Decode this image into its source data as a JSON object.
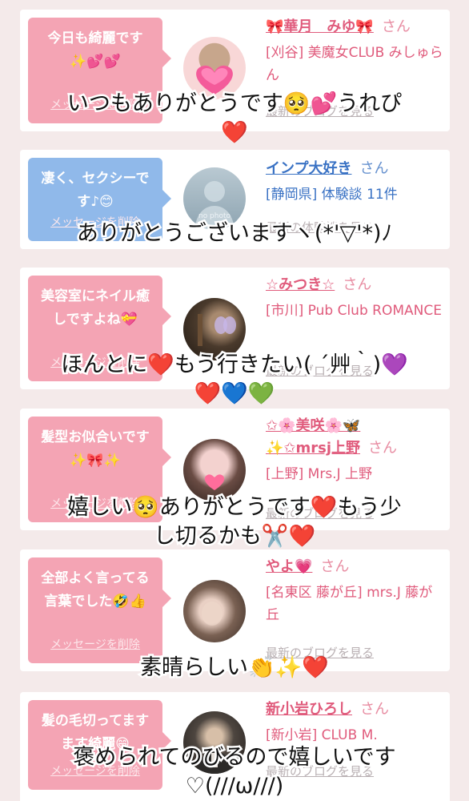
{
  "cards": [
    {
      "bubble_text": "今日も綺麗です\n✨💕💕",
      "delete_label": "メッセージを削除",
      "user_name": "🎀華月　みゆ🎀",
      "honorific": "さん",
      "shop": "[刈谷] 美魔女CLUB みしゅらん",
      "blog_label": "最新のブログを見る",
      "avatar_icon": "hearts-avatar"
    },
    {
      "bubble_text": "凄く、セクシーです♪😊",
      "delete_label": "メッセージを削除",
      "user_name": "インプ大好き",
      "honorific": "さん",
      "shop": "[静岡県] 体験談 11件",
      "blog_label": "最新の体験談を見る",
      "avatar_placeholder": "no photo"
    },
    {
      "bubble_text": "美容室にネイル癒しですよね💝",
      "delete_label": "メッセージを削除",
      "user_name": "☆みつき☆",
      "honorific": "さん",
      "shop": "[市川] Pub Club ROMANCE",
      "blog_label": "最新のブログを見る",
      "avatar_icon": "bar-photo-avatar"
    },
    {
      "bubble_text": "髪型お似合いです\n✨🎀✨",
      "delete_label": "メッセージを削除",
      "user_name_line1": "✩🌸美咲🌸🦋",
      "user_name": "✨✩mrsj上野",
      "honorific": "さん",
      "shop": "[上野] Mrs.J 上野",
      "blog_label": "最新のブログを見る",
      "avatar_icon": "woman-photo-avatar"
    },
    {
      "bubble_text": "全部よく言ってる言葉でした🤣👍",
      "delete_label": "メッセージを削除",
      "user_name": "やよ💗",
      "honorific": "さん",
      "shop": "[名東区 藤が丘] mrs.J 藤が丘",
      "blog_label": "最新のブログを見る",
      "avatar_icon": "woman-photo-avatar"
    },
    {
      "bubble_text": "髪の毛切ってますます綺麗😄",
      "delete_label": "メッセージを削除",
      "user_name": "新小岩ひろし",
      "honorific": "さん",
      "shop": "[新小岩] CLUB M.",
      "blog_label": "最新のブログを見る",
      "avatar_icon": "man-photo-avatar"
    }
  ],
  "captions": [
    {
      "line1": "いつもありがとうです🥺💕うれぴ",
      "line2": "❤️"
    },
    {
      "line1": "ありがとうございますヽ(*'▽'*)ﾉ"
    },
    {
      "line1": "ほんとに❤️もう行きたい( ´艸｀)💜",
      "line2": "❤️💙💚"
    },
    {
      "line1": "嬉しい🥺ありがとうです❤️もう少",
      "line2": "し切るかも✂️❤️"
    },
    {
      "line1": "素晴らしい👏✨❤️"
    },
    {
      "line1": "褒められてのびるので嬉しいです",
      "line2": "♡(///ω///)"
    }
  ],
  "colors": {
    "bubble_pink": "#f4a4b4",
    "bubble_blue": "#90b9ea",
    "name_pink": "#e05b7c",
    "name_blue": "#3a72c4",
    "background": "#f4eaea"
  }
}
